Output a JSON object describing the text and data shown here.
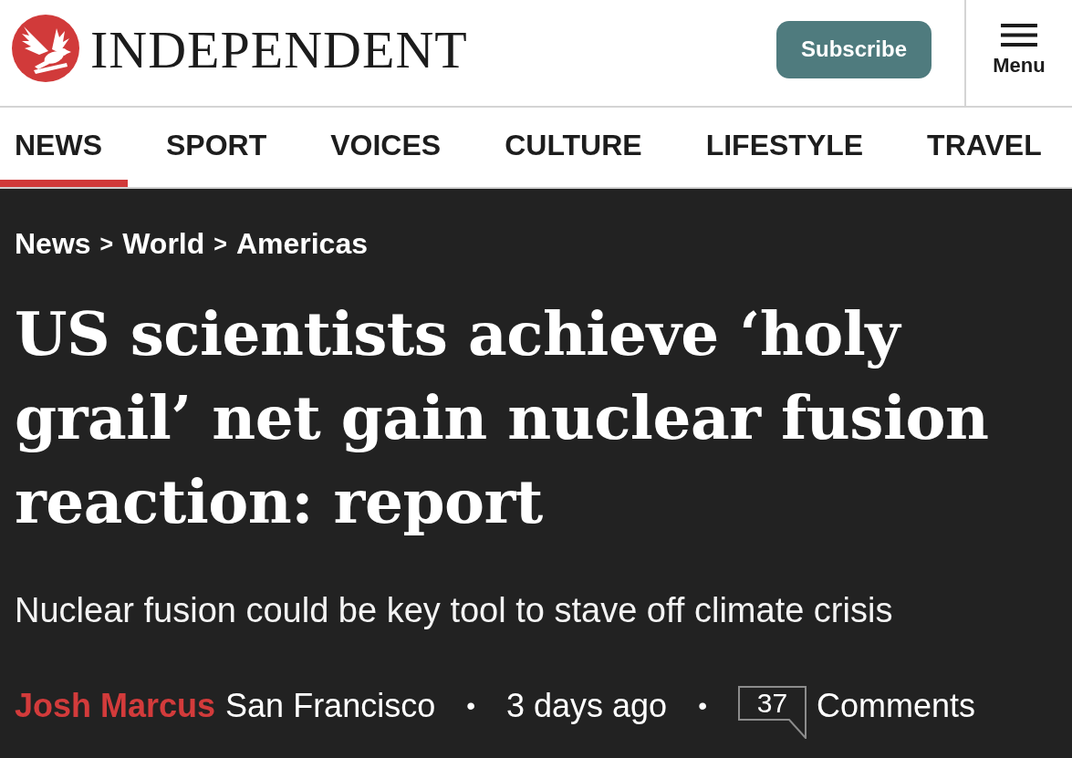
{
  "header": {
    "wordmark": "INDEPENDENT",
    "subscribe_button": "Subscribe",
    "menu_button": "Menu"
  },
  "nav": [
    {
      "label": "NEWS",
      "selected": true
    },
    {
      "label": "SPORT",
      "selected": false
    },
    {
      "label": "VOICES",
      "selected": false
    },
    {
      "label": "CULTURE",
      "selected": false
    },
    {
      "label": "LIFESTYLE",
      "selected": false
    },
    {
      "label": "TRAVEL",
      "selected": false
    }
  ],
  "article": {
    "breadcrumb": [
      {
        "label": "News",
        "separator": ">"
      },
      {
        "label": "World",
        "separator": ">"
      },
      {
        "label": "Americas"
      }
    ],
    "headline": "US scientists achieve ‘holy grail’ net gain nuclear fusion reaction: report",
    "standfirst": "Nuclear fusion could be key tool to stave off climate crisis",
    "byline": {
      "author": "Josh Marcus",
      "location": "San Francisco",
      "separator_1": "•",
      "published": "3 days ago",
      "separator_2": "•",
      "comment_count": "37",
      "comments_label": "Comments"
    }
  }
}
